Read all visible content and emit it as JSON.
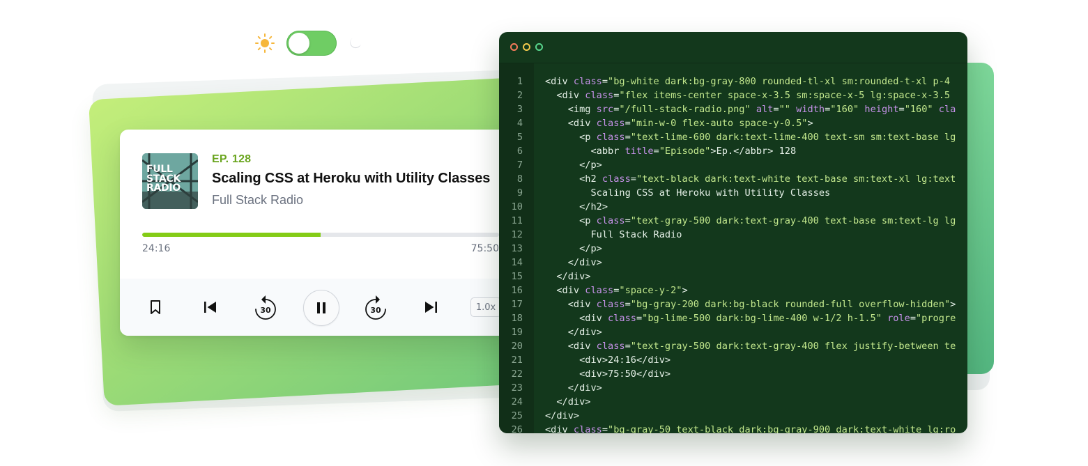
{
  "theme_toggle": {
    "sun_icon": "sun-icon",
    "moon_icon": "moon-icon",
    "state": "light"
  },
  "player": {
    "cover_text": "FULL STACK RADIO",
    "episode": "EP. 128",
    "title": "Scaling CSS at Heroku with Utility Classes",
    "show": "Full Stack Radio",
    "progress_fraction": 0.5,
    "current_time": "24:16",
    "total_time": "75:50",
    "controls": {
      "bookmark_icon": "bookmark-icon",
      "prev_icon": "skip-back-icon",
      "rewind_label": "30",
      "play_icon": "pause-icon",
      "forward_label": "30",
      "next_icon": "skip-forward-icon",
      "speed_label": "1.0x"
    },
    "colors": {
      "accent": "#84cc16",
      "episode": "#6aa51f"
    }
  },
  "editor": {
    "lines": [
      {
        "n": "1",
        "html": "<span class=\"tag\">&lt;div </span><span class=\"attr\">class</span><span class=\"tag\">=</span><span class=\"val\">\"bg-white dark:bg-gray-800 rounded-tl-xl sm:rounded-t-xl p-4</span>"
      },
      {
        "n": "2",
        "html": "  <span class=\"tag\">&lt;div </span><span class=\"attr\">class</span><span class=\"tag\">=</span><span class=\"val\">\"flex items-center space-x-3.5 sm:space-x-5 lg:space-x-3.5</span>"
      },
      {
        "n": "3",
        "html": "    <span class=\"tag\">&lt;img </span><span class=\"attr\">src</span><span class=\"tag\">=</span><span class=\"val\">\"/full-stack-radio.png\"</span> <span class=\"attr\">alt</span><span class=\"tag\">=</span><span class=\"val\">\"\"</span> <span class=\"attr\">width</span><span class=\"tag\">=</span><span class=\"val\">\"160\"</span> <span class=\"attr\">height</span><span class=\"tag\">=</span><span class=\"val\">\"160\"</span> <span class=\"attr\">cla</span>"
      },
      {
        "n": "4",
        "html": "    <span class=\"tag\">&lt;div </span><span class=\"attr\">class</span><span class=\"tag\">=</span><span class=\"val\">\"min-w-0 flex-auto space-y-0.5\"</span><span class=\"tag\">&gt;</span>"
      },
      {
        "n": "5",
        "html": "      <span class=\"tag\">&lt;p </span><span class=\"attr\">class</span><span class=\"tag\">=</span><span class=\"val\">\"text-lime-600 dark:text-lime-400 text-sm sm:text-base lg</span>"
      },
      {
        "n": "6",
        "html": "        <span class=\"tag\">&lt;abbr </span><span class=\"attr\">title</span><span class=\"tag\">=</span><span class=\"val\">\"Episode\"</span><span class=\"tag\">&gt;</span><span class=\"txt\">Ep.</span><span class=\"tag\">&lt;/abbr&gt;</span><span class=\"txt\"> 128</span>"
      },
      {
        "n": "7",
        "html": "      <span class=\"tag\">&lt;/p&gt;</span>"
      },
      {
        "n": "8",
        "html": "      <span class=\"tag\">&lt;h2 </span><span class=\"attr\">class</span><span class=\"tag\">=</span><span class=\"val\">\"text-black dark:text-white text-base sm:text-xl lg:text</span>"
      },
      {
        "n": "9",
        "html": "        <span class=\"txt\">Scaling CSS at Heroku with Utility Classes</span>"
      },
      {
        "n": "10",
        "html": "      <span class=\"tag\">&lt;/h2&gt;</span>"
      },
      {
        "n": "11",
        "html": "      <span class=\"tag\">&lt;p </span><span class=\"attr\">class</span><span class=\"tag\">=</span><span class=\"val\">\"text-gray-500 dark:text-gray-400 text-base sm:text-lg lg</span>"
      },
      {
        "n": "12",
        "html": "        <span class=\"txt\">Full Stack Radio</span>"
      },
      {
        "n": "13",
        "html": "      <span class=\"tag\">&lt;/p&gt;</span>"
      },
      {
        "n": "14",
        "html": "    <span class=\"tag\">&lt;/div&gt;</span>"
      },
      {
        "n": "15",
        "html": "  <span class=\"tag\">&lt;/div&gt;</span>"
      },
      {
        "n": "16",
        "html": "  <span class=\"tag\">&lt;div </span><span class=\"attr\">class</span><span class=\"tag\">=</span><span class=\"val\">\"space-y-2\"</span><span class=\"tag\">&gt;</span>"
      },
      {
        "n": "17",
        "html": "    <span class=\"tag\">&lt;div </span><span class=\"attr\">class</span><span class=\"tag\">=</span><span class=\"val\">\"bg-gray-200 dark:bg-black rounded-full overflow-hidden\"</span><span class=\"tag\">&gt;</span>"
      },
      {
        "n": "18",
        "html": "      <span class=\"tag\">&lt;div </span><span class=\"attr\">class</span><span class=\"tag\">=</span><span class=\"val\">\"bg-lime-500 dark:bg-lime-400 w-1/2 h-1.5\"</span> <span class=\"attr\">role</span><span class=\"tag\">=</span><span class=\"val\">\"progre</span>"
      },
      {
        "n": "19",
        "html": "    <span class=\"tag\">&lt;/div&gt;</span>"
      },
      {
        "n": "20",
        "html": "    <span class=\"tag\">&lt;div </span><span class=\"attr\">class</span><span class=\"tag\">=</span><span class=\"val\">\"text-gray-500 dark:text-gray-400 flex justify-between te</span>"
      },
      {
        "n": "21",
        "html": "      <span class=\"tag\">&lt;div&gt;</span><span class=\"txt\">24:16</span><span class=\"tag\">&lt;/div&gt;</span>"
      },
      {
        "n": "22",
        "html": "      <span class=\"tag\">&lt;div&gt;</span><span class=\"txt\">75:50</span><span class=\"tag\">&lt;/div&gt;</span>"
      },
      {
        "n": "23",
        "html": "    <span class=\"tag\">&lt;/div&gt;</span>"
      },
      {
        "n": "24",
        "html": "  <span class=\"tag\">&lt;/div&gt;</span>"
      },
      {
        "n": "25",
        "html": "<span class=\"tag\">&lt;/div&gt;</span>"
      },
      {
        "n": "26",
        "html": "<span class=\"tag\">&lt;div </span><span class=\"attr\">class</span><span class=\"tag\">=</span><span class=\"val\">\"bg-gray-50 text-black dark:bg-gray-900 dark:text-white lg:ro</span>"
      }
    ],
    "window_dots": [
      "red",
      "yellow",
      "green"
    ],
    "colors": {
      "background": "#13381c",
      "attr": "#c792ea",
      "string": "#c3e88d"
    }
  }
}
